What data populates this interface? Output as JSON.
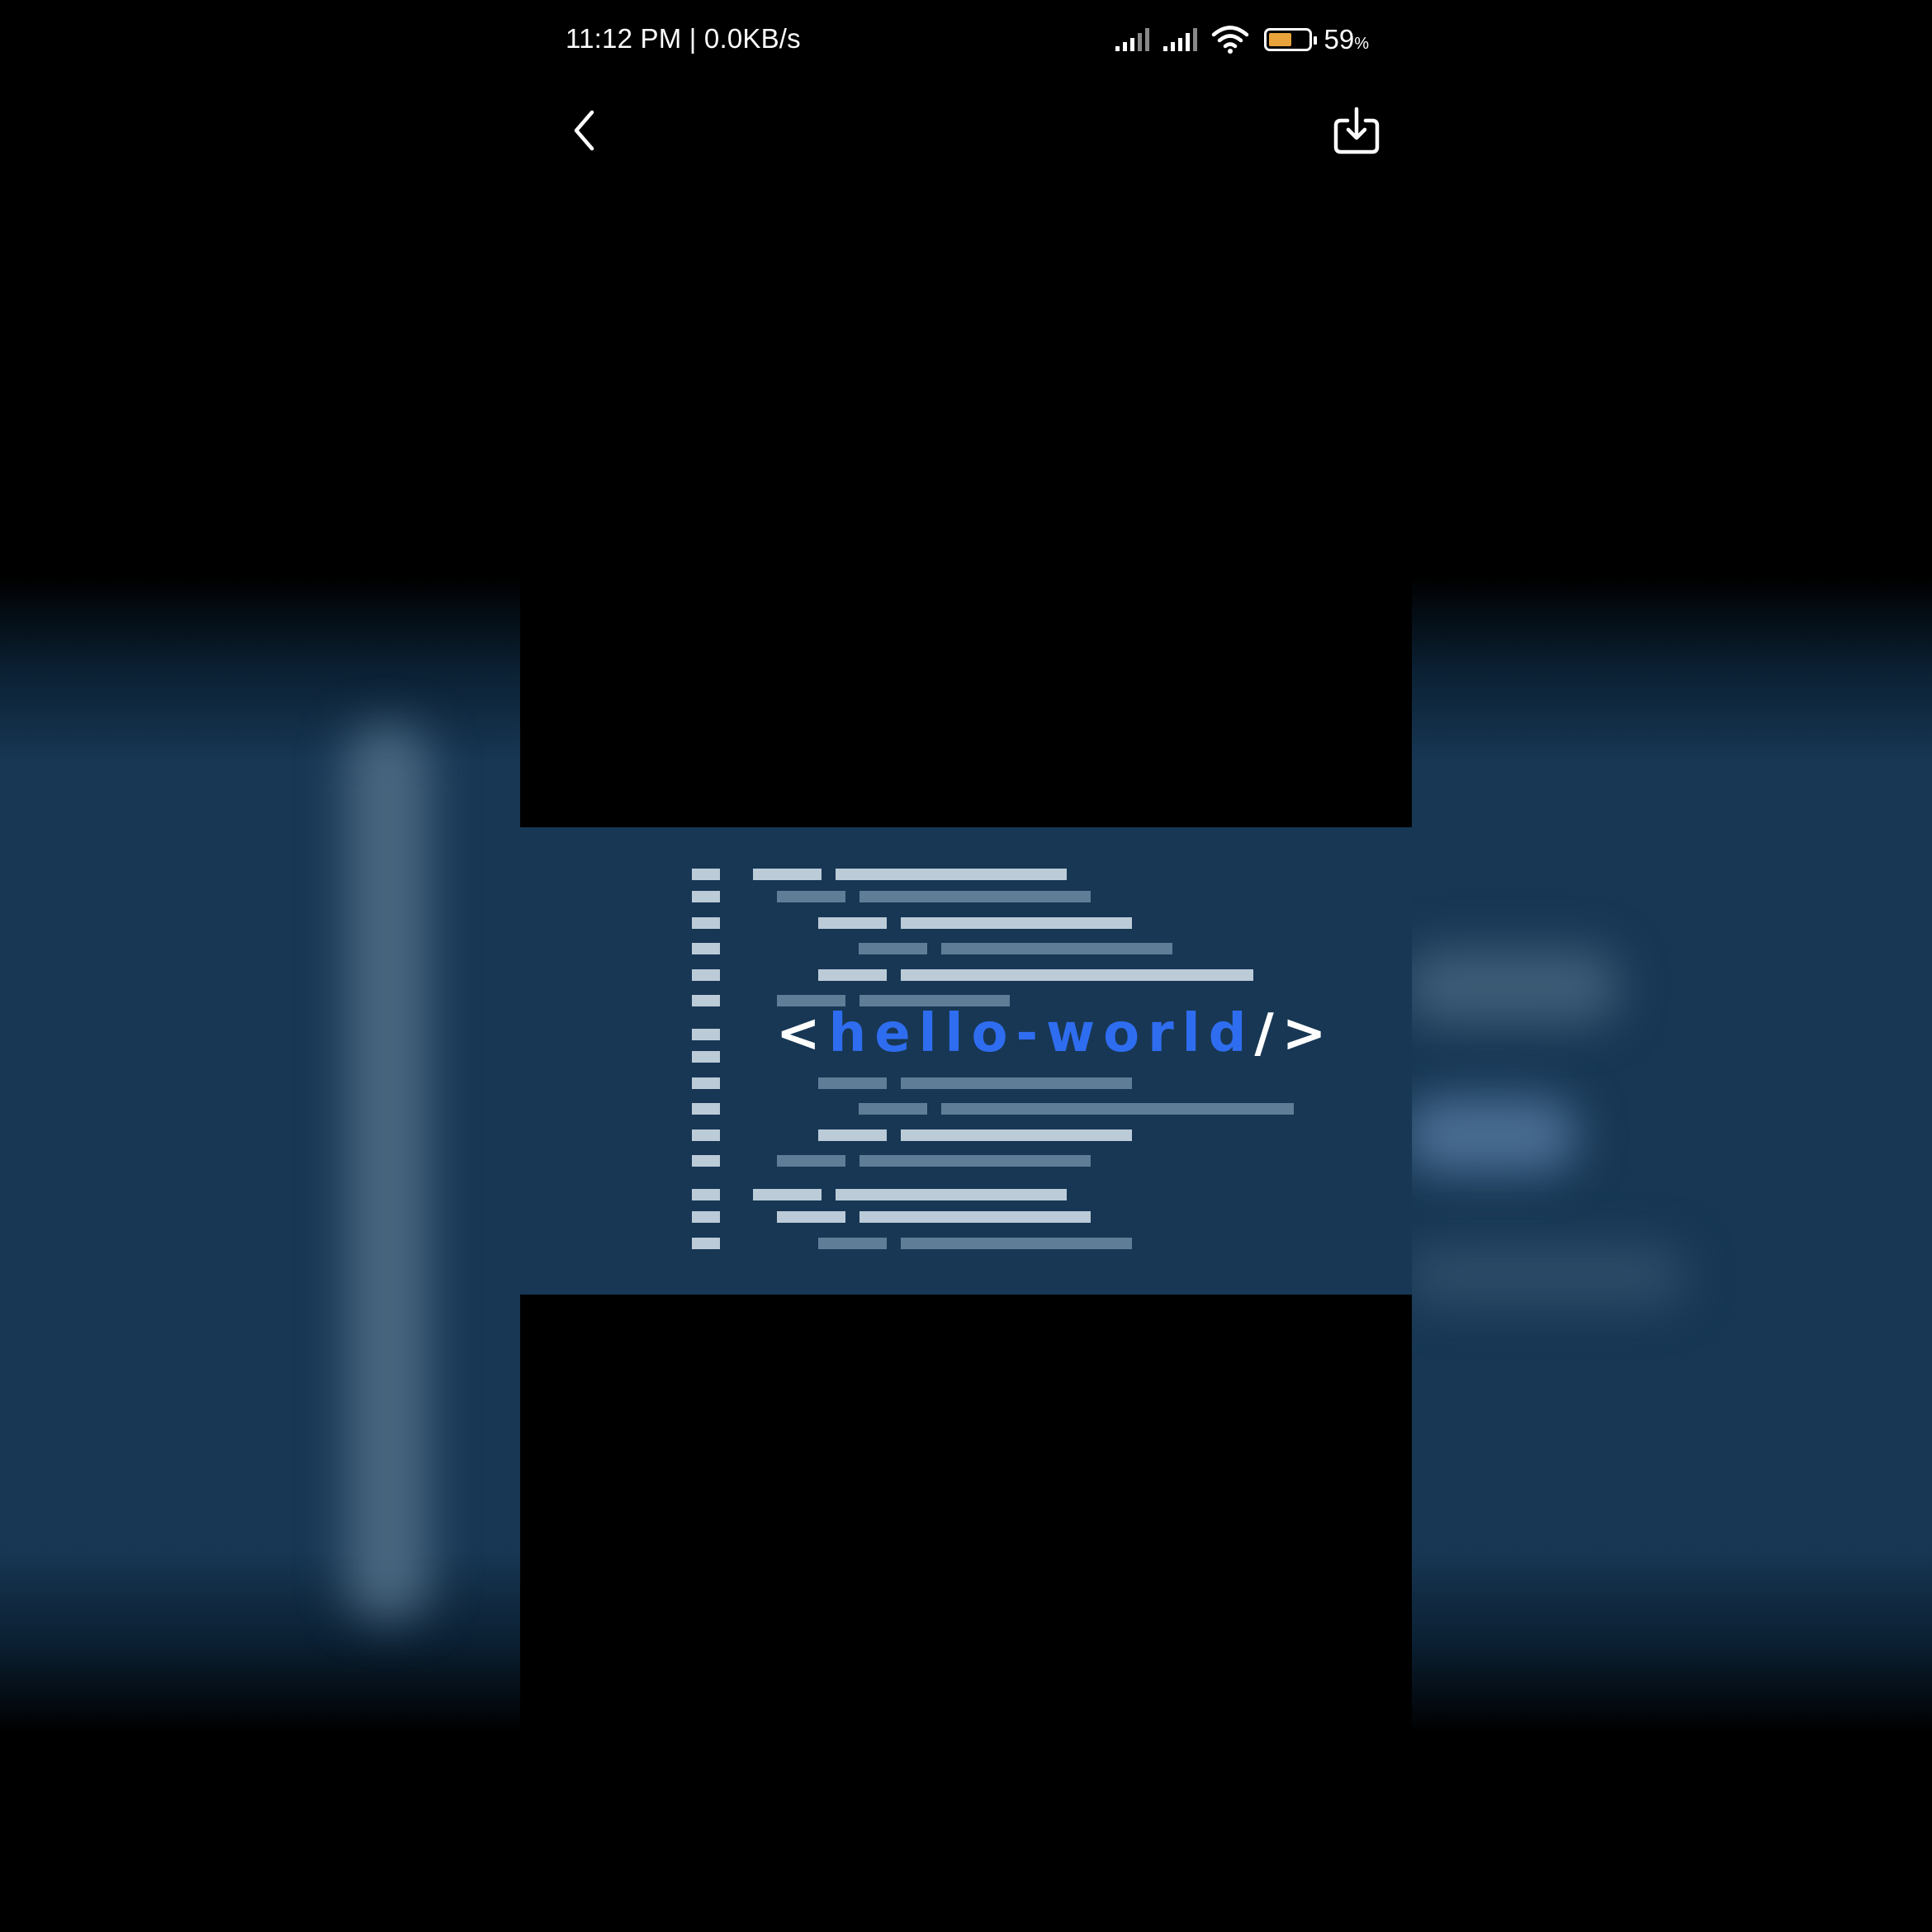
{
  "status_bar": {
    "time_speed": "11:12 PM | 0.0KB/s",
    "battery_percent": "59",
    "battery_unit": "%",
    "battery_level": 0.59,
    "battery_color": "#e8a33a"
  },
  "toolbar": {
    "back_icon": "chevron-left-icon",
    "download_icon": "download-tray-icon"
  },
  "image": {
    "background_color": "#173754",
    "title_open": "<",
    "title_name": "hello-world",
    "title_close": "/>",
    "title_accent_color": "#2f6df0"
  }
}
